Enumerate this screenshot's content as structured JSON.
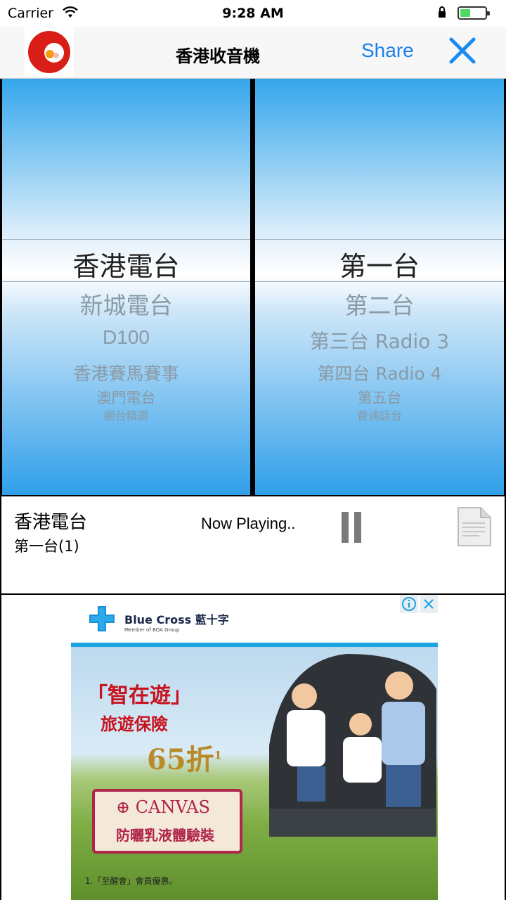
{
  "status_bar": {
    "carrier": "Carrier",
    "time": "9:28 AM"
  },
  "nav": {
    "title": "香港收音機",
    "share_label": "Share"
  },
  "picker_left": {
    "selected": "香港電台",
    "items": [
      "新城電台",
      "D100",
      "香港賽馬賽事",
      "澳門電台",
      "網台精選"
    ]
  },
  "picker_right": {
    "selected": "第一台",
    "items": [
      "第二台",
      "第三台 Radio 3",
      "第四台 Radio 4",
      "第五台",
      "普通話台"
    ]
  },
  "player": {
    "station": "香港電台",
    "channel": "第一台(1)",
    "status": "Now Playing.."
  },
  "ad": {
    "brand": "Blue Cross 藍十字",
    "tagline": "Member of BOA Group",
    "slogan": "「智在遊」",
    "product": "旅遊保險",
    "discount": "65折",
    "discount_note": "1",
    "canvas_title": "CANVAS",
    "canvas_subtitle": "防曬乳液體驗裝",
    "footnote": "1.「至醒會」會員優惠。",
    "colors": {
      "accent": "#c7141f",
      "brand_blue": "#1aa3e0"
    }
  },
  "colors": {
    "picker_top": "#34a6ec",
    "share": "#1a7ff0"
  }
}
